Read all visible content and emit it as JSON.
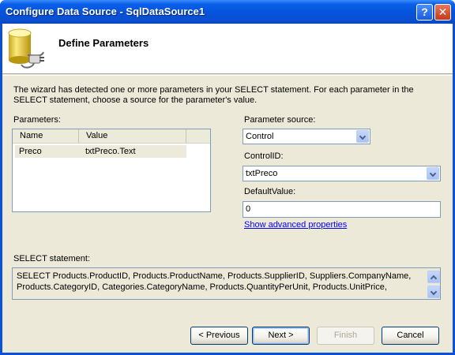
{
  "window": {
    "title": "Configure Data Source - SqlDataSource1",
    "help_glyph": "?",
    "close_glyph": "✕"
  },
  "header": {
    "title": "Define Parameters",
    "icon": "database-plug-icon"
  },
  "description": "The wizard has detected one or more parameters in your SELECT statement. For each parameter in the SELECT statement, choose a source for the parameter's value.",
  "parameters": {
    "label": "Parameters:",
    "columns": [
      "Name",
      "Value"
    ],
    "rows": [
      {
        "name": "Preco",
        "value": "txtPreco.Text"
      }
    ]
  },
  "parameter_source": {
    "label": "Parameter source:",
    "value": "Control"
  },
  "control_id": {
    "label": "ControlID:",
    "value": "txtPreco"
  },
  "default_value": {
    "label": "DefaultValue:",
    "value": "0"
  },
  "advanced_link": "Show advanced properties",
  "select_statement": {
    "label": "SELECT statement:",
    "text": "SELECT Products.ProductID, Products.ProductName, Products.SupplierID, Suppliers.CompanyName,\nProducts.CategoryID, Categories.CategoryName, Products.QuantityPerUnit, Products.UnitPrice,"
  },
  "buttons": {
    "previous": "< Previous",
    "next": "Next >",
    "finish": "Finish",
    "cancel": "Cancel"
  },
  "colors": {
    "title_bar": "#0553dd",
    "dialog_bg": "#ece9d8",
    "link": "#0000ff"
  }
}
